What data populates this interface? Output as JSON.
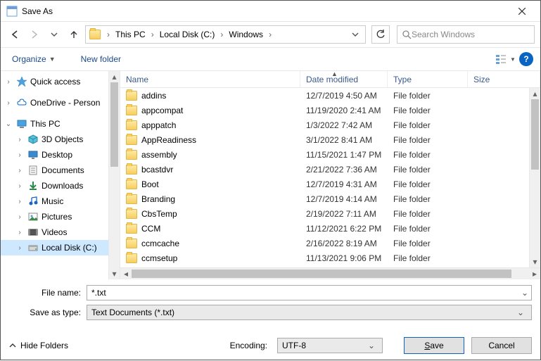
{
  "window": {
    "title": "Save As"
  },
  "breadcrumb": {
    "items": [
      "This PC",
      "Local Disk (C:)",
      "Windows"
    ]
  },
  "search": {
    "placeholder": "Search Windows"
  },
  "toolbar": {
    "organize": "Organize",
    "newfolder": "New folder"
  },
  "columns": {
    "name": "Name",
    "date": "Date modified",
    "type": "Type",
    "size": "Size"
  },
  "tree": [
    {
      "indent": 0,
      "twisty": "›",
      "icon": "star",
      "label": "Quick access"
    },
    {
      "indent": 0,
      "twisty": "›",
      "icon": "cloud",
      "label": "OneDrive - Person"
    },
    {
      "indent": 0,
      "twisty": "⌄",
      "icon": "pc",
      "label": "This PC"
    },
    {
      "indent": 1,
      "twisty": "›",
      "icon": "3d",
      "label": "3D Objects"
    },
    {
      "indent": 1,
      "twisty": "›",
      "icon": "desktop",
      "label": "Desktop"
    },
    {
      "indent": 1,
      "twisty": "›",
      "icon": "doc",
      "label": "Documents"
    },
    {
      "indent": 1,
      "twisty": "›",
      "icon": "dl",
      "label": "Downloads"
    },
    {
      "indent": 1,
      "twisty": "›",
      "icon": "music",
      "label": "Music"
    },
    {
      "indent": 1,
      "twisty": "›",
      "icon": "pic",
      "label": "Pictures"
    },
    {
      "indent": 1,
      "twisty": "›",
      "icon": "vid",
      "label": "Videos"
    },
    {
      "indent": 1,
      "twisty": "›",
      "icon": "disk",
      "label": "Local Disk (C:)",
      "selected": true
    }
  ],
  "files": [
    {
      "name": "addins",
      "date": "12/7/2019 4:50 AM",
      "type": "File folder"
    },
    {
      "name": "appcompat",
      "date": "11/19/2020 2:41 AM",
      "type": "File folder"
    },
    {
      "name": "apppatch",
      "date": "1/3/2022 7:42 AM",
      "type": "File folder"
    },
    {
      "name": "AppReadiness",
      "date": "3/1/2022 8:41 AM",
      "type": "File folder"
    },
    {
      "name": "assembly",
      "date": "11/15/2021 1:47 PM",
      "type": "File folder"
    },
    {
      "name": "bcastdvr",
      "date": "2/21/2022 7:36 AM",
      "type": "File folder"
    },
    {
      "name": "Boot",
      "date": "12/7/2019 4:31 AM",
      "type": "File folder"
    },
    {
      "name": "Branding",
      "date": "12/7/2019 4:14 AM",
      "type": "File folder"
    },
    {
      "name": "CbsTemp",
      "date": "2/19/2022 7:11 AM",
      "type": "File folder"
    },
    {
      "name": "CCM",
      "date": "11/12/2021 6:22 PM",
      "type": "File folder"
    },
    {
      "name": "ccmcache",
      "date": "2/16/2022 8:19 AM",
      "type": "File folder"
    },
    {
      "name": "ccmsetup",
      "date": "11/13/2021 9:06 PM",
      "type": "File folder"
    }
  ],
  "form": {
    "filename_label": "File name:",
    "filename_value": "*.txt",
    "type_label": "Save as type:",
    "type_value": "Text Documents (*.txt)"
  },
  "footer": {
    "hidefolders": "Hide Folders",
    "encoding_label": "Encoding:",
    "encoding_value": "UTF-8",
    "save": "Save",
    "save_ul": "S",
    "save_rest": "ave",
    "cancel": "Cancel"
  }
}
